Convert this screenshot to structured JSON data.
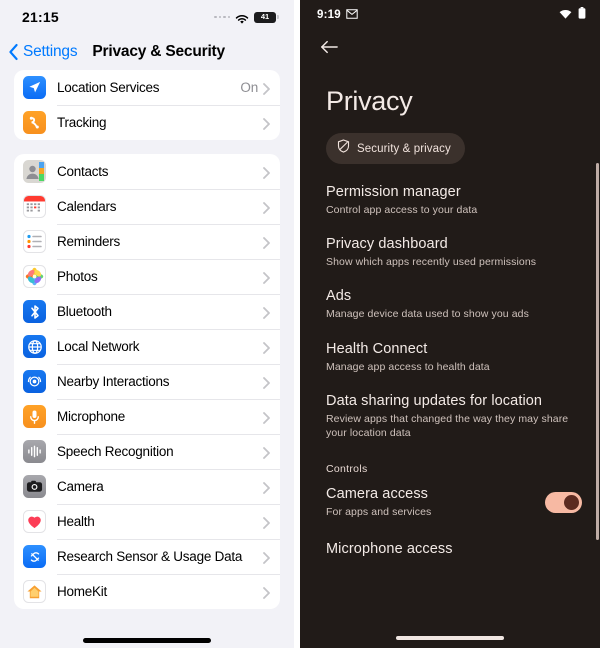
{
  "ios": {
    "status": {
      "time": "21:15",
      "battery_level": "41",
      "wifi_icon": "wifi-icon",
      "cellular_icon": "cellular-dots-icon",
      "battery_icon": "battery-icon"
    },
    "navbar": {
      "back_label": "Settings",
      "back_icon": "chevron-left-icon",
      "title": "Privacy & Security"
    },
    "groups": [
      {
        "rows": [
          {
            "label": "Location Services",
            "value": "On",
            "icon": "location-services-icon"
          },
          {
            "label": "Tracking",
            "value": "",
            "icon": "tracking-icon"
          }
        ]
      },
      {
        "rows": [
          {
            "label": "Contacts",
            "value": "",
            "icon": "contacts-icon"
          },
          {
            "label": "Calendars",
            "value": "",
            "icon": "calendars-icon"
          },
          {
            "label": "Reminders",
            "value": "",
            "icon": "reminders-icon"
          },
          {
            "label": "Photos",
            "value": "",
            "icon": "photos-icon"
          },
          {
            "label": "Bluetooth",
            "value": "",
            "icon": "bluetooth-icon"
          },
          {
            "label": "Local Network",
            "value": "",
            "icon": "local-network-icon"
          },
          {
            "label": "Nearby Interactions",
            "value": "",
            "icon": "nearby-interactions-icon"
          },
          {
            "label": "Microphone",
            "value": "",
            "icon": "microphone-icon"
          },
          {
            "label": "Speech Recognition",
            "value": "",
            "icon": "speech-recognition-icon"
          },
          {
            "label": "Camera",
            "value": "",
            "icon": "camera-icon"
          },
          {
            "label": "Health",
            "value": "",
            "icon": "health-icon"
          },
          {
            "label": "Research Sensor & Usage Data",
            "value": "",
            "icon": "research-sensor-icon"
          },
          {
            "label": "HomeKit",
            "value": "",
            "icon": "homekit-icon"
          }
        ]
      }
    ],
    "colors": {
      "accent": "#007aff",
      "background": "#f2f2f7",
      "card": "#ffffff",
      "secondary_text": "#8e8e93"
    }
  },
  "android": {
    "status": {
      "time": "9:19",
      "notification_icon": "gmail-icon",
      "wifi_icon": "wifi-icon",
      "battery_icon": "battery-icon"
    },
    "back_icon": "arrow-left-icon",
    "title": "Privacy",
    "chip": {
      "label": "Security & privacy",
      "icon": "shield-icon"
    },
    "items": [
      {
        "title": "Permission manager",
        "subtitle": "Control app access to your data"
      },
      {
        "title": "Privacy dashboard",
        "subtitle": "Show which apps recently used permissions"
      },
      {
        "title": "Ads",
        "subtitle": "Manage device data used to show you ads"
      },
      {
        "title": "Health Connect",
        "subtitle": "Manage app access to health data"
      },
      {
        "title": "Data sharing updates for location",
        "subtitle": "Review apps that changed the way they may share your location data"
      }
    ],
    "section_header": "Controls",
    "controls": [
      {
        "title": "Camera access",
        "subtitle": "For apps and services",
        "toggle_state": "on"
      },
      {
        "title": "Microphone access",
        "subtitle": "",
        "toggle_state": ""
      }
    ],
    "colors": {
      "background": "#211b18",
      "chip": "#3b312c",
      "toggle_track_on": "#f7b9a3",
      "toggle_knob": "#5c2a20",
      "primary_text": "#f3eae6",
      "secondary_text": "#cfc2bc"
    }
  }
}
